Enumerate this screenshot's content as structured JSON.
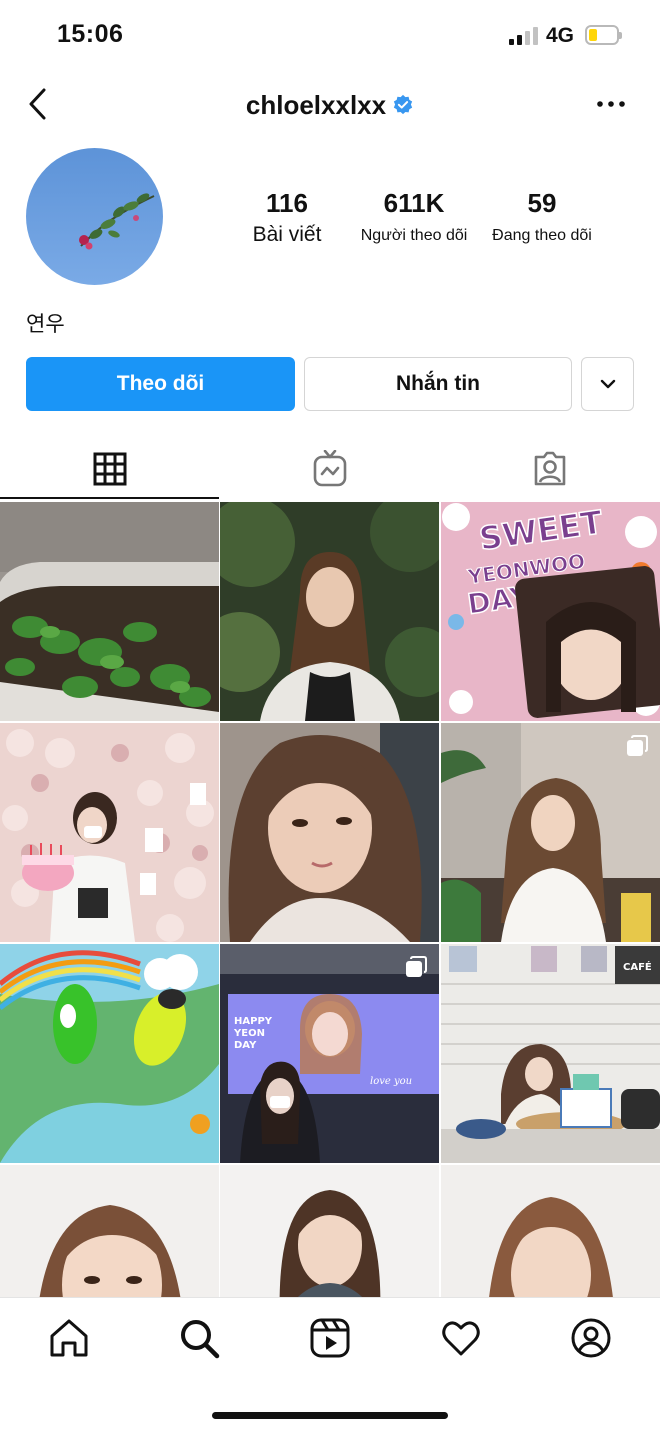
{
  "status_bar": {
    "time": "15:06",
    "network": "4G"
  },
  "header": {
    "username": "chloelxxlxx"
  },
  "profile": {
    "stats": [
      {
        "value": "116",
        "label": "Bài viết"
      },
      {
        "value": "611K",
        "label": "Người theo dõi"
      },
      {
        "value": "59",
        "label": "Đang theo dõi"
      }
    ],
    "bio_name": "연우"
  },
  "actions": {
    "follow_label": "Theo dõi",
    "message_label": "Nhắn tin"
  },
  "grid": {
    "post3_text": [
      "SWEET",
      "YEONWOO",
      "DAY"
    ],
    "post8_screen_text": [
      "HAPPY",
      "YEON",
      "DAY"
    ],
    "post8_screen_caption": "love you",
    "post9_sign": "CAFÉ"
  },
  "colors": {
    "accent": "#1a95f7",
    "verified": "#3897f0",
    "battery": "#ffd60a"
  },
  "icons": [
    "back-arrow-icon",
    "verified-badge-icon",
    "more-options-icon",
    "chevron-down-icon",
    "grid-icon",
    "igtv-icon",
    "tagged-icon",
    "multi-post-icon",
    "home-icon",
    "search-icon",
    "reels-icon",
    "heart-icon",
    "profile-icon"
  ]
}
